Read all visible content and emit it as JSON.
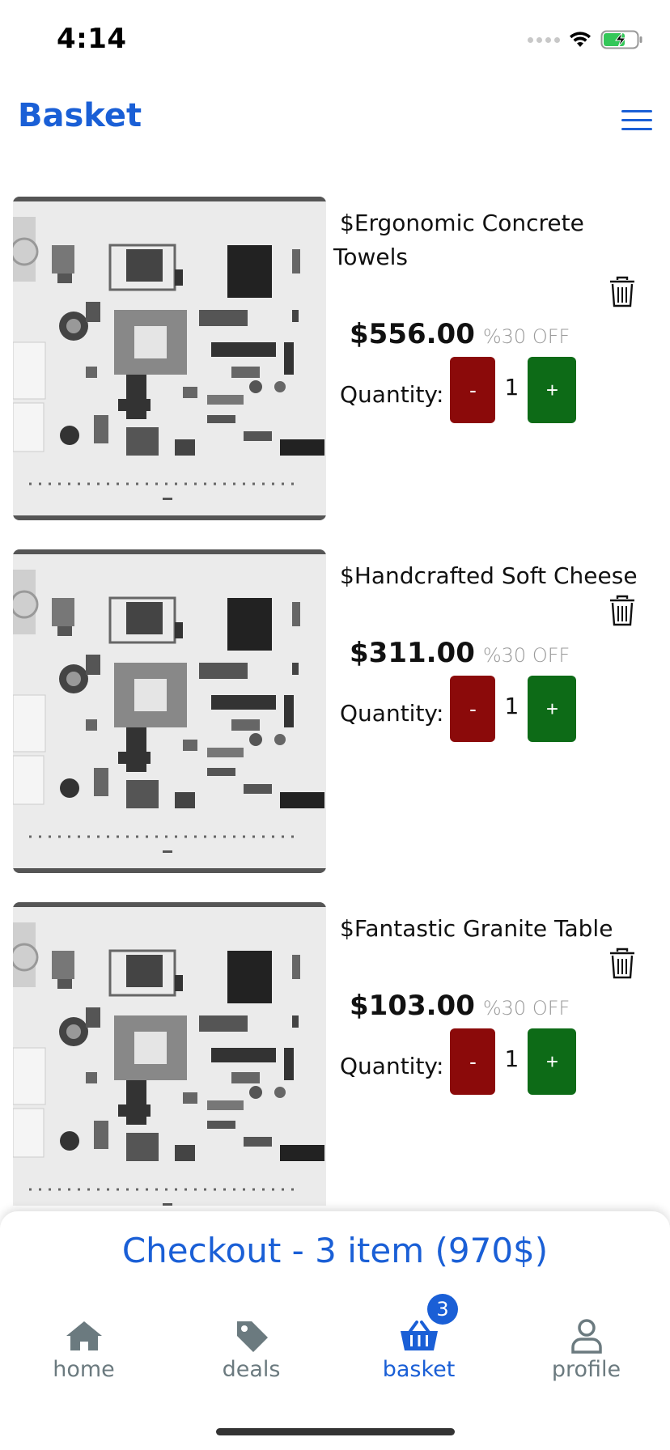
{
  "status_bar": {
    "time": "4:14"
  },
  "header": {
    "title": "Basket"
  },
  "items": [
    {
      "title": "$Ergonomic Concrete Towels",
      "price": "$556.00",
      "discount": "%30 OFF",
      "quantity_label": "Quantity:",
      "quantity": "1",
      "minus": "-",
      "plus": "+"
    },
    {
      "title": "$Handcrafted Soft Cheese",
      "price": "$311.00",
      "discount": "%30 OFF",
      "quantity_label": "Quantity:",
      "quantity": "1",
      "minus": "-",
      "plus": "+"
    },
    {
      "title": "$Fantastic Granite Table",
      "price": "$103.00",
      "discount": "%30 OFF",
      "quantity_label": "Quantity:",
      "quantity": "1",
      "minus": "-",
      "plus": "+"
    }
  ],
  "checkout": {
    "label": "Checkout - 3 item (970$)"
  },
  "tabs": [
    {
      "label": "home",
      "icon": "home-icon"
    },
    {
      "label": "deals",
      "icon": "tag-icon"
    },
    {
      "label": "basket",
      "icon": "basket-icon",
      "badge": "3",
      "active": true
    },
    {
      "label": "profile",
      "icon": "person-icon"
    }
  ],
  "colors": {
    "accent": "#1a5fd6",
    "minus": "#8b0a0a",
    "plus": "#0d6b17",
    "tab_inactive": "#6b7a7f"
  }
}
